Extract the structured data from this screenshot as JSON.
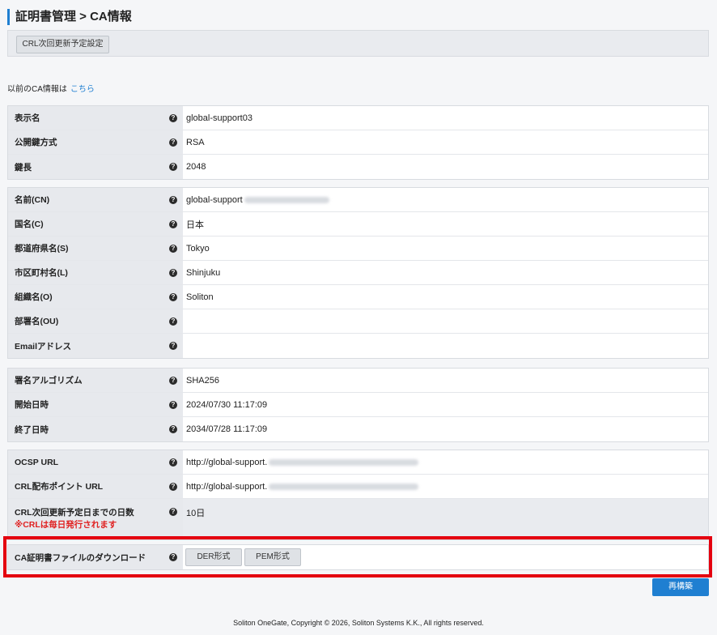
{
  "header": {
    "title": "証明書管理 > CA情報"
  },
  "toolbar": {
    "crl_button": "CRL次回更新予定設定"
  },
  "prev": {
    "text": "以前のCA情報は",
    "link": "こちら"
  },
  "help_glyph": "?",
  "group1": [
    {
      "label": "表示名",
      "value": "global-support03"
    },
    {
      "label": "公開鍵方式",
      "value": "RSA"
    },
    {
      "label": "鍵長",
      "value": "2048"
    }
  ],
  "group2": [
    {
      "label": "名前(CN)",
      "value": "global-support"
    },
    {
      "label": "国名(C)",
      "value": "日本"
    },
    {
      "label": "都道府県名(S)",
      "value": "Tokyo"
    },
    {
      "label": "市区町村名(L)",
      "value": "Shinjuku"
    },
    {
      "label": "組織名(O)",
      "value": "Soliton"
    },
    {
      "label": "部署名(OU)",
      "value": ""
    },
    {
      "label": "Emailアドレス",
      "value": ""
    }
  ],
  "group3": [
    {
      "label": "署名アルゴリズム",
      "value": "SHA256"
    },
    {
      "label": "開始日時",
      "value": "2024/07/30 11:17:09"
    },
    {
      "label": "終了日時",
      "value": "2034/07/28 11:17:09"
    }
  ],
  "group4": [
    {
      "label": "OCSP URL",
      "value": "http://global-support."
    },
    {
      "label": "CRL配布ポイント URL",
      "value": "http://global-support."
    },
    {
      "label": "CRL次回更新予定日までの日数",
      "note": "※CRLは毎日発行されます",
      "value": "10日"
    }
  ],
  "download": {
    "label": "CA証明書ファイルのダウンロード",
    "der_button": "DER形式",
    "pem_button": "PEM形式"
  },
  "rebuild_button": "再構築",
  "footer": "Soliton OneGate, Copyright © 2026, Soliton Systems K.K., All rights reserved.",
  "colors": {
    "accent": "#1f7fd1",
    "highlight": "#e4000f",
    "note": "#e02020"
  }
}
